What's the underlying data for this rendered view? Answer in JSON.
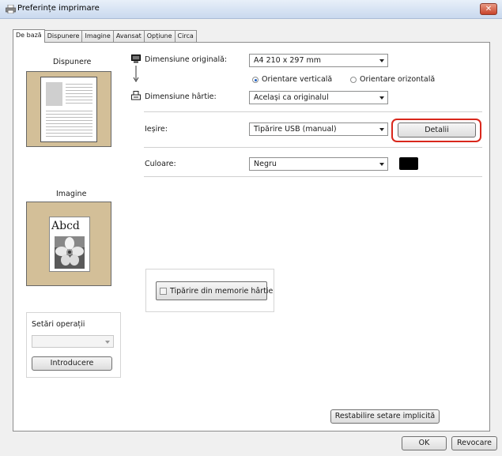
{
  "window": {
    "title": "Preferințe imprimare",
    "close_glyph": "✕"
  },
  "tabs": [
    "De bază",
    "Dispunere",
    "Imagine",
    "Avansat",
    "Opțiune",
    "Circa"
  ],
  "left": {
    "layout_label": "Dispunere",
    "image_label": "Imagine",
    "image_sample_text": "Abcd",
    "ops": {
      "title": "Setări operații",
      "select_value": "",
      "button": "Introducere"
    }
  },
  "form": {
    "orig_size_label": "Dimensiune originală:",
    "orig_size_value": "A4 210 x 297 mm",
    "orientation_portrait": "Orientare verticală",
    "orientation_landscape": "Orientare orizontală",
    "orientation_selected": "portrait",
    "paper_size_label": "Dimensiune hârtie:",
    "paper_size_value": "Același ca originalul",
    "output_label": "Ieșire:",
    "output_value": "Tipărire USB (manual)",
    "details_button": "Detalii",
    "color_label": "Culoare:",
    "color_value": "Negru",
    "memory_print": "Tipărire din memorie hârtie",
    "memory_print_checked": false,
    "restore_button": "Restabilire setare implicită"
  },
  "footer": {
    "ok": "OK",
    "cancel": "Revocare"
  },
  "colors": {
    "highlight": "#d9271c",
    "preview_bg": "#d3bf98"
  },
  "icons": [
    "printer-icon",
    "close-icon",
    "monitor-icon",
    "arrow-down-icon",
    "paper-icon",
    "black-swatch-icon"
  ]
}
